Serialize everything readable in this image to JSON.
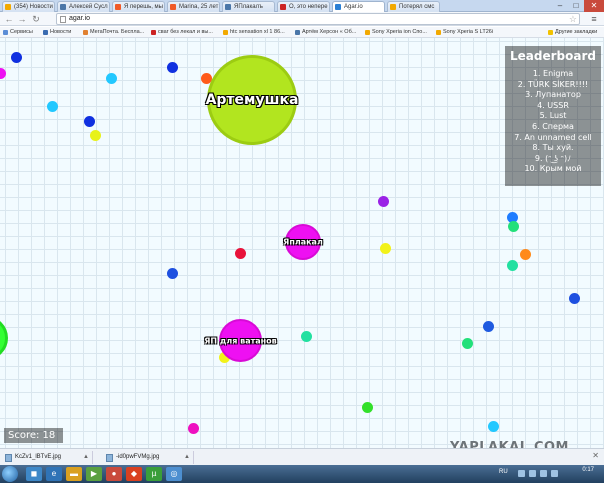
{
  "browser": {
    "tabs": [
      {
        "label": "(354) Новости",
        "color": "#f2a900"
      },
      {
        "label": "Алексей Сусл",
        "color": "#4a76a8"
      },
      {
        "label": "Я перешь, мы",
        "color": "#f05a28"
      },
      {
        "label": "Marina, 25 лет",
        "color": "#f05a28"
      },
      {
        "label": "ЯПлакалъ",
        "color": "#4a76a8"
      },
      {
        "label": "О, это непере",
        "color": "#cc2222"
      },
      {
        "label": "Agar.io",
        "color": "#2a7fd4"
      },
      {
        "label": "Потерял смс",
        "color": "#f2a900"
      }
    ],
    "address": "agar.io",
    "bookmarks": [
      {
        "label": "Сервисы",
        "color": "#5b8dd6"
      },
      {
        "label": "Новости",
        "color": "#3a6bb0"
      },
      {
        "label": "МегаПочта. Беспла...",
        "color": "#e08030"
      },
      {
        "label": "сваг без лекал и вы...",
        "color": "#cc2222"
      },
      {
        "label": "htc sensation xl 1 86...",
        "color": "#f2a900"
      },
      {
        "label": "Артём Херсон « Об...",
        "color": "#4a76a8"
      },
      {
        "label": "Sony Xperia ion Спо...",
        "color": "#f2a900"
      },
      {
        "label": "Sony Xperia S LT26i",
        "color": "#f2a900"
      },
      {
        "label": "Другие закладки",
        "color": "#f2c200"
      }
    ]
  },
  "game": {
    "leaderboard": {
      "title": "Leaderboard",
      "entries": [
        "1. Enigma",
        "2. TÜRK SİKER!!!!",
        "3. Лупанатор",
        "4. USSR",
        "5. Lust",
        "6. Сперма",
        "7. An unnamed cell",
        "8. Ты хуй.",
        "9. (ᵔ ͜ʖ ᵔ)ﾉ",
        "10. Крым мой"
      ]
    },
    "score_label": "Score: 18",
    "cells": [
      {
        "name": "Артемушка",
        "color": "#b2e51f"
      },
      {
        "name": "Яплакал",
        "color": "#ee10f2"
      },
      {
        "name": "ЯП для ватанов",
        "color": "#ee10f2"
      }
    ],
    "watermark": "YAPLAKAL.COM"
  },
  "downloads": {
    "items": [
      "KcZv1_lBTvE.jpg",
      "-id0pwFVMg.jpg"
    ],
    "show_all": ""
  },
  "taskbar": {
    "lang": "RU",
    "time": "0:17"
  }
}
